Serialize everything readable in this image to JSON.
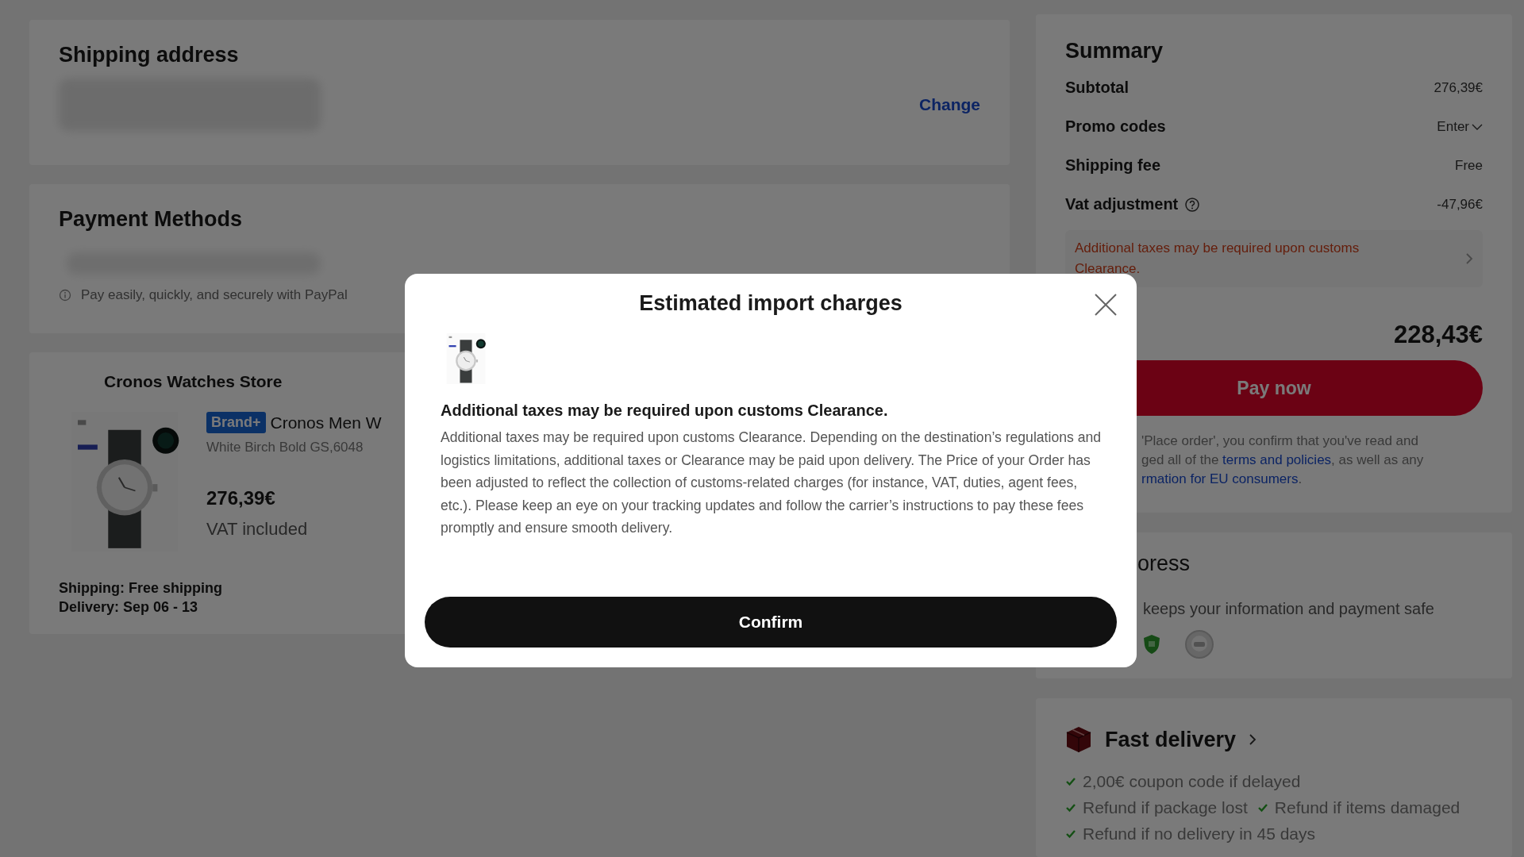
{
  "shipping_address": {
    "title": "Shipping address",
    "action": "Change"
  },
  "payment_methods": {
    "title": "Payment Methods",
    "note": "Pay easily, quickly, and securely with PayPal"
  },
  "store": {
    "name": "Cronos Watches Store",
    "product": {
      "badge": "Brand+",
      "title": "Cronos Men W",
      "variant": "White Birch Bold GS,6048",
      "price": "276,39€",
      "tax_note": "VAT included"
    },
    "shipping": "Shipping: Free shipping",
    "delivery": "Delivery: Sep 06 - 13"
  },
  "summary": {
    "title": "Summary",
    "rows": [
      {
        "label": "Subtotal",
        "value": "276,39€",
        "kind": "plain"
      },
      {
        "label": "Promo codes",
        "value": "Enter",
        "kind": "dropdown"
      },
      {
        "label": "Shipping fee",
        "value": "Free",
        "kind": "plain"
      },
      {
        "label": "Vat adjustment",
        "value": "-47,96€",
        "kind": "help"
      }
    ],
    "notice": "Additional taxes may be required upon customs Clearance.",
    "total": "228,43€",
    "pay_button": "Pay now",
    "disclaimer_lines": [
      [
        {
          "text": "'Place order', you confirm that you've read and",
          "link": false
        }
      ],
      [
        {
          "text": "ged all of the ",
          "link": false
        },
        {
          "text": "terms and policies",
          "link": true
        },
        {
          "text": ", as well as any",
          "link": false
        }
      ],
      [
        {
          "text": "rmation for EU consumers",
          "link": true
        },
        {
          "text": ".",
          "link": false
        }
      ]
    ]
  },
  "security": {
    "title": "oress",
    "text": "keeps your information and payment safe"
  },
  "fast_delivery": {
    "title": "Fast delivery",
    "perks": [
      "2,00€ coupon code if delayed",
      "Refund if package lost",
      "Refund if items damaged",
      "Refund if no delivery in 45 days"
    ]
  },
  "modal": {
    "title": "Estimated import charges",
    "heading": "Additional taxes may be required upon customs Clearance.",
    "body": "Additional taxes may be required upon customs Clearance. Depending on the destination’s regulations and logistics limitations, additional taxes or Clearance may be paid upon delivery. The Price of your Order has been adjusted to reflect the collection of customs-related charges (for instance, VAT, duties, agent fees, etc.). Please keep an eye on your tracking updates and follow the carrier’s instructions to pay these fees promptly and ensure smooth delivery.",
    "confirm": "Confirm"
  }
}
